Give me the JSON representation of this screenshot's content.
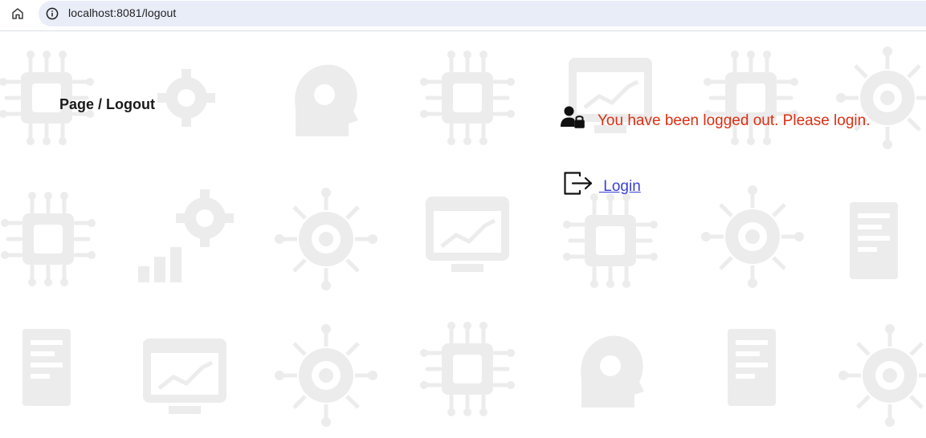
{
  "browser": {
    "url": "localhost:8081/logout",
    "icons": {
      "home": "home-icon",
      "site_info": "info-icon"
    }
  },
  "page": {
    "breadcrumb": "Page / Logout",
    "message": "You have been logged out. Please login.",
    "message_color": "#dc2f12",
    "login_label": " Login",
    "link_color": "#3a3fd6",
    "icons": {
      "user_lock": "user-lock-icon",
      "logout": "logout-arrow-icon"
    },
    "background_pattern": "ai-technology-icons"
  }
}
